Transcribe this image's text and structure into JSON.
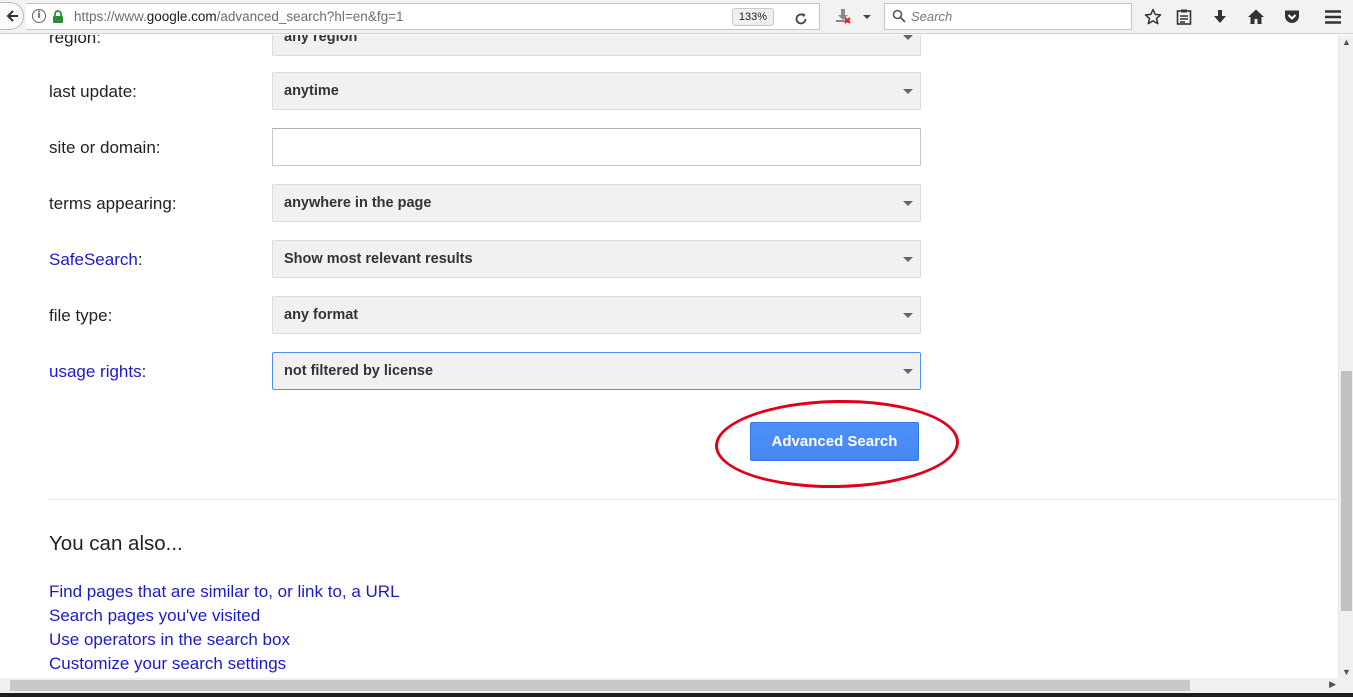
{
  "browser": {
    "url_prefix": "https://www.",
    "url_host": "google.com",
    "url_path": "/advanced_search?hl=en&fg=1",
    "zoom": "133%",
    "search_placeholder": "Search"
  },
  "form": {
    "region": {
      "label": "region:",
      "value": "any region"
    },
    "last_update": {
      "label": "last update:",
      "value": "anytime"
    },
    "site_or_domain": {
      "label": "site or domain:",
      "value": ""
    },
    "terms_appearing": {
      "label": "terms appearing:",
      "value": "anywhere in the page"
    },
    "safesearch": {
      "label": "SafeSearch",
      "suffix": ":",
      "value": "Show most relevant results"
    },
    "file_type": {
      "label": "file type:",
      "value": "any format"
    },
    "usage_rights": {
      "label": "usage rights",
      "suffix": ":",
      "value": "not filtered by license"
    },
    "submit_label": "Advanced Search"
  },
  "also": {
    "title": "You can also...",
    "links": [
      "Find pages that are similar to, or link to, a URL",
      "Search pages you've visited",
      "Use operators in the search box",
      "Customize your search settings"
    ]
  },
  "colors": {
    "link": "#1a1acb",
    "button": "#4d90fe",
    "annotation": "#e0001a"
  }
}
